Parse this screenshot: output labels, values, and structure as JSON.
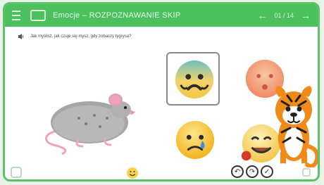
{
  "header": {
    "title": "Emocje – ROZPOZNAWANIE SKIP",
    "counter": "01 / 14"
  },
  "question": {
    "text": "Jak myślisz, jak czuje się mysz, gdy zobaczy tygrysa?"
  },
  "choices": [
    {
      "label": "scared"
    },
    {
      "label": "surprised"
    },
    {
      "label": "sad"
    },
    {
      "label": "happy"
    }
  ],
  "colors": {
    "accent": "#4cbf5f"
  },
  "footer": {
    "actions": [
      "undo-icon",
      "redo-icon",
      "check-icon"
    ]
  }
}
